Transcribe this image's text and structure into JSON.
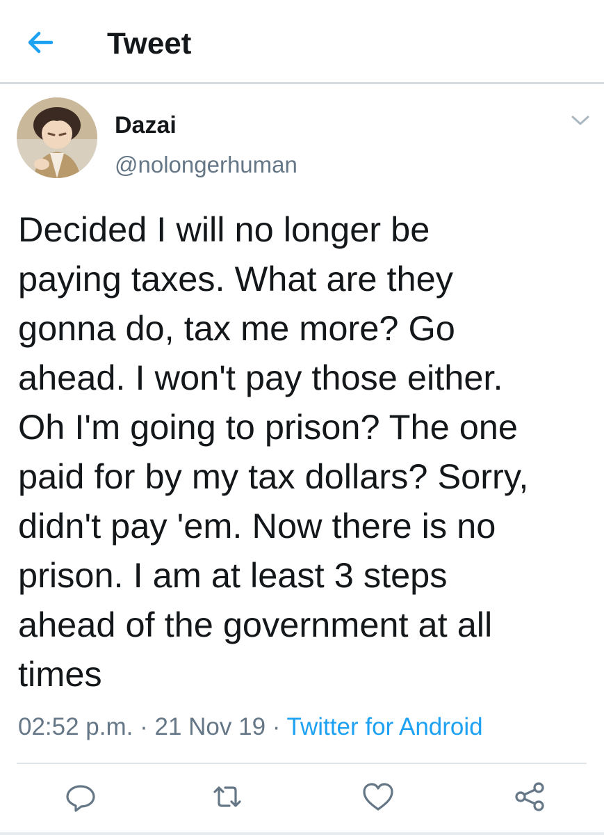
{
  "header": {
    "title": "Tweet",
    "back_icon": "arrow-left-icon",
    "accent_color": "#1da1f2"
  },
  "tweet": {
    "author": {
      "display_name": "Dazai",
      "handle": "@nolongerhuman",
      "avatar_icon": "avatar"
    },
    "text": "Decided I will no longer be\npaying taxes. What are they\ngonna do, tax me more? Go\nahead. I won't pay those either.\nOh I'm going to prison? The one\npaid for by my tax dollars? Sorry,\ndidn't pay 'em. Now there is no\nprison. I am at least 3 steps\nahead of the government at all\ntimes",
    "time": "02:52 p.m.",
    "separator": " · ",
    "date": "21 Nov 19",
    "source": "Twitter for Android"
  },
  "actions": {
    "reply_icon": "reply-icon",
    "retweet_icon": "retweet-icon",
    "like_icon": "heart-icon",
    "share_icon": "share-icon",
    "icon_color": "#657786"
  }
}
